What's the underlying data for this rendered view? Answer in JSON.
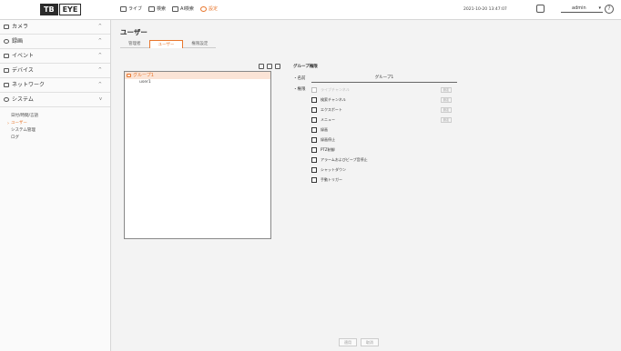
{
  "logo": {
    "left": "TB",
    "right": "EYE"
  },
  "topnav": {
    "items": [
      {
        "label": "ライブ"
      },
      {
        "label": "検索"
      },
      {
        "label": "AI検索"
      },
      {
        "label": "設定",
        "active": true
      }
    ]
  },
  "datetime": "2021-10-20 13:47:07",
  "user": {
    "name": "admin"
  },
  "help_symbol": "?",
  "sidebar": {
    "items": [
      {
        "label": "カメラ",
        "icon": "camera-icon",
        "chevron": "^"
      },
      {
        "label": "録画",
        "icon": "record-icon",
        "chevron": "^"
      },
      {
        "label": "イベント",
        "icon": "event-icon",
        "chevron": "^"
      },
      {
        "label": "デバイス",
        "icon": "device-icon",
        "chevron": "^"
      },
      {
        "label": "ネットワーク",
        "icon": "network-icon",
        "chevron": "^"
      },
      {
        "label": "システム",
        "icon": "system-icon",
        "chevron": "v"
      }
    ],
    "sub_items": [
      {
        "label": "日付/時間/言語"
      },
      {
        "label": "ユーザー",
        "active": true
      },
      {
        "label": "システム管理"
      },
      {
        "label": "ログ"
      }
    ]
  },
  "main": {
    "title": "ユーザー",
    "tabs": [
      {
        "label": "管理者"
      },
      {
        "label": "ユーザー",
        "active": true
      },
      {
        "label": "権限設定"
      }
    ],
    "tree": {
      "group": "グループ1",
      "users": [
        "user1"
      ]
    },
    "permissions": {
      "header": "グループ権限",
      "name_label": "・名前",
      "name_value": "グループ1",
      "perm_label": "・権限",
      "items": [
        {
          "label": "ライブチャンネル",
          "disabled": true,
          "button": "設定"
        },
        {
          "label": "検索チャンネル",
          "button": "設定"
        },
        {
          "label": "エクスポート",
          "button": "設定"
        },
        {
          "label": "メニュー",
          "button": "設定"
        },
        {
          "label": "録画"
        },
        {
          "label": "録画停止"
        },
        {
          "label": "PTZ制御"
        },
        {
          "label": "アラームおよびビープ音停止"
        },
        {
          "label": "シャットダウン"
        },
        {
          "label": "手動トリガー"
        }
      ]
    },
    "buttons": {
      "apply": "適用",
      "cancel": "取消"
    }
  },
  "colors": {
    "accent": "#e8772e",
    "group_highlight": "#fbe4d6"
  }
}
